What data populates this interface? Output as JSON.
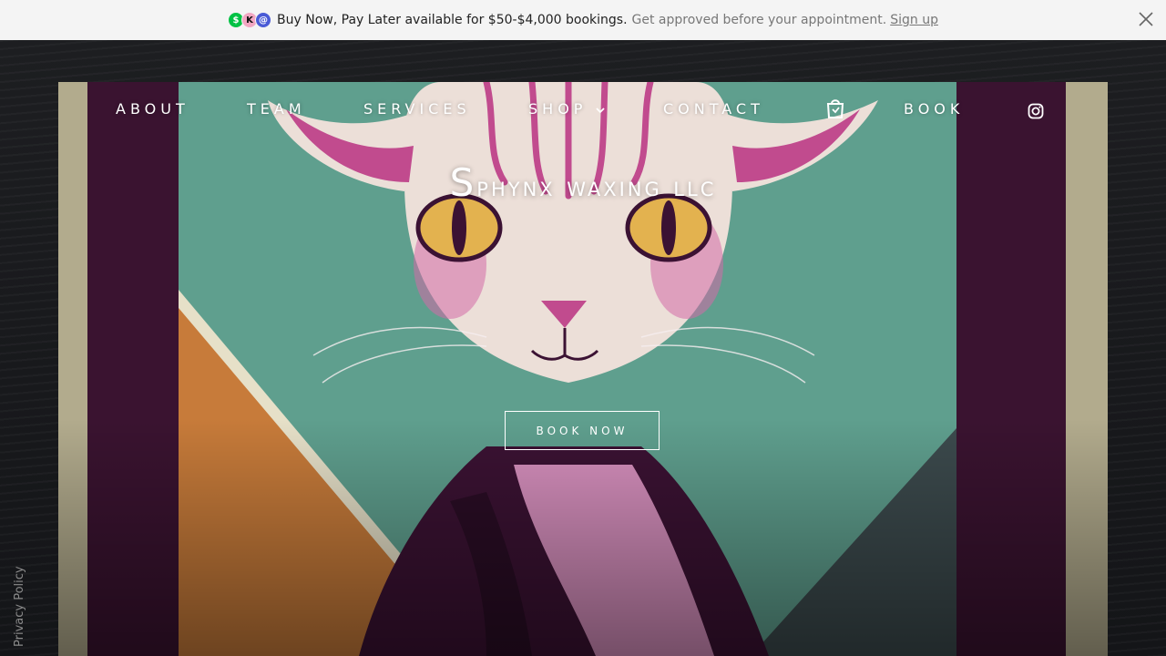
{
  "banner": {
    "main_text": "Buy Now, Pay Later available for $50-$4,000 bookings.",
    "sub_text": "Get approved before your appointment.",
    "signup_label": "Sign up",
    "logos": [
      {
        "name": "cash-app-logo",
        "glyph": "$",
        "color": "#00c244"
      },
      {
        "name": "klarna-logo",
        "glyph": "K",
        "color": "#f2a6c2"
      },
      {
        "name": "afterpay-logo",
        "glyph": "@",
        "color": "#4a5bd6"
      }
    ]
  },
  "nav": {
    "about": "ABOUT",
    "team": "TEAM",
    "services": "SERVICES",
    "shop": "SHOP",
    "contact": "CONTACT",
    "book": "BOOK"
  },
  "hero": {
    "title_first": "S",
    "title_rest": "phynx waxing llc",
    "button_label": "BOOK NOW"
  },
  "footer": {
    "privacy_label": "Privacy Policy"
  },
  "colors": {
    "banner_bg": "#f4f4f4",
    "page_bg": "#141518",
    "frame_purple": "#3a1330",
    "teal": "#5fa08f",
    "orange": "#c77b3a",
    "pink": "#c14b8e"
  }
}
